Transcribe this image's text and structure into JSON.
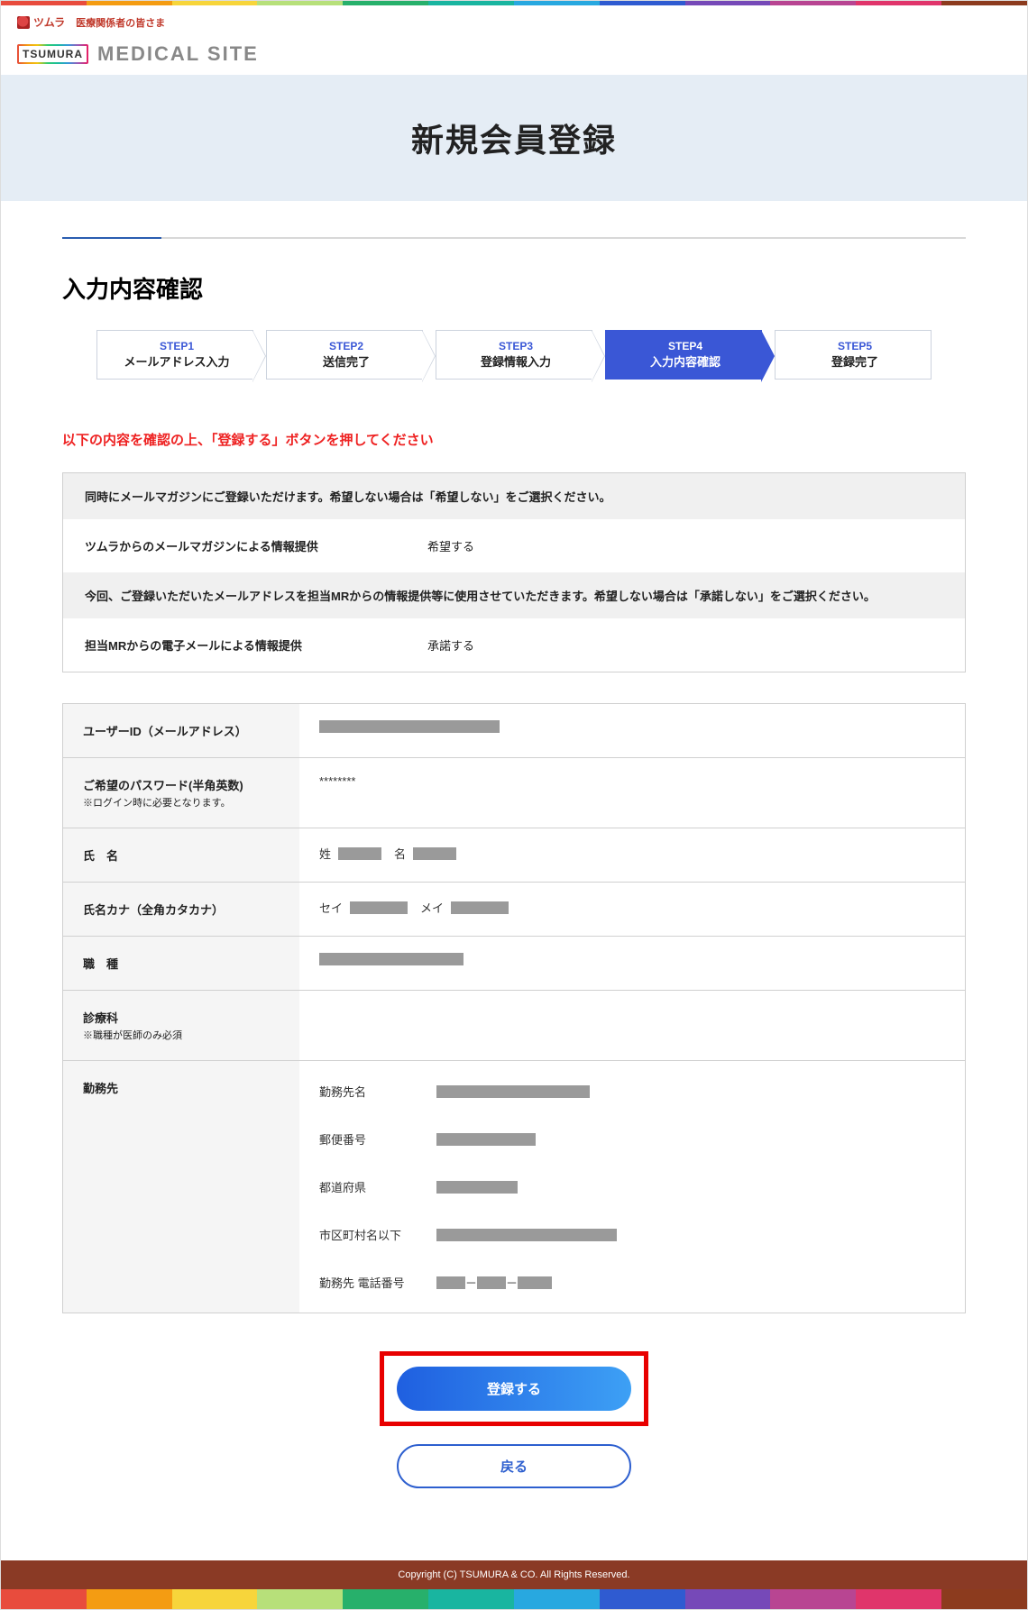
{
  "brand": {
    "logo_text": "ツムラ",
    "header_sub": "医療関係者の皆さま",
    "badge_text": "TSUMURA",
    "site_name": "MEDiCAL SiTE"
  },
  "hero_title": "新規会員登録",
  "sub_title": "入力内容確認",
  "steps": [
    {
      "no": "STEP1",
      "label": "メールアドレス入力"
    },
    {
      "no": "STEP2",
      "label": "送信完了"
    },
    {
      "no": "STEP3",
      "label": "登録情報入力"
    },
    {
      "no": "STEP4",
      "label": "入力内容確認"
    },
    {
      "no": "STEP5",
      "label": "登録完了"
    }
  ],
  "active_step_index": 3,
  "notice_text": "以下の内容を確認の上、「登録する」ボタンを押してください",
  "mailmag": {
    "header": "同時にメールマガジンにご登録いただけます。希望しない場合は「希望しない」をご選択ください。",
    "label": "ツムラからのメールマガジンによる情報提供",
    "value": "希望する"
  },
  "mr_mail": {
    "header": "今回、ご登録いただいたメールアドレスを担当MRからの情報提供等に使用させていただきます。希望しない場合は「承諾しない」をご選択ください。",
    "label": "担当MRからの電子メールによる情報提供",
    "value": "承諾する"
  },
  "form": {
    "user_id": {
      "label": "ユーザーID（メールアドレス）"
    },
    "password": {
      "label": "ご希望のパスワード(半角英数)",
      "note": "※ログイン時に必要となります。",
      "value": "********"
    },
    "name": {
      "label": "氏　名",
      "sei_label": "姓",
      "mei_label": "名"
    },
    "kana": {
      "label": "氏名カナ（全角カタカナ）",
      "sei_label": "セイ",
      "mei_label": "メイ"
    },
    "occupation": {
      "label": "職　種"
    },
    "department": {
      "label": "診療科",
      "note": "※職種が医師のみ必須"
    },
    "work": {
      "label": "勤務先",
      "name_label": "勤務先名",
      "zip_label": "郵便番号",
      "pref_label": "都道府県",
      "addr_label": "市区町村名以下",
      "tel_label": "勤務先 電話番号",
      "tel_sep": "－"
    }
  },
  "buttons": {
    "submit": "登録する",
    "back": "戻る"
  },
  "footer": "Copyright (C) TSUMURA & CO. All Rights Reserved.",
  "stripe_colors": [
    "#e84c3d",
    "#f49c12",
    "#f7d53b",
    "#b7e07a",
    "#27b06b",
    "#19b5a0",
    "#28a8e0",
    "#2f5bd1",
    "#7649b8",
    "#b84592",
    "#e0356b",
    "#8c3b1e"
  ]
}
